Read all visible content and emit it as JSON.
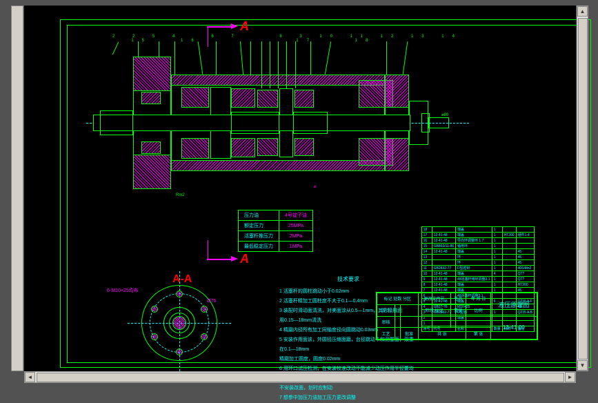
{
  "section_marker": "A",
  "section_label": "A-A",
  "balloons": [
    "2",
    "2",
    "5",
    "4",
    "6",
    "7",
    "8",
    "3",
    "10",
    "11",
    "12",
    "13",
    "14",
    "15",
    "16",
    "17",
    "18"
  ],
  "param_table": [
    {
      "label": "压力油",
      "value": "4号锭子油"
    },
    {
      "label": "额定压力",
      "value": "25MPa"
    },
    {
      "label": "活塞杆推压力",
      "value": "2MPa"
    },
    {
      "label": "最低稳定压力",
      "value": "1MPa"
    }
  ],
  "flange": {
    "bolt_spec": "6-M10×25均布",
    "diameter": "Ø76"
  },
  "notes_title": "技术要求",
  "notes": [
    "1 活塞杆的圆柱跳动小于0.02mm",
    "2 活塞杆精加工圆柱度不大于0.1—0.4mm",
    "3 装配时滑动面清洗，对美面涂从0.5—1mm，其它接触面",
    "  用0.15—18mm清洗",
    "4 精磨内径所有加工同轴度径向圆跳动0.03mm",
    "5 安装作用面该，外圆径压缩面磨，台径跳动卡和测量面，双重在0.1—18mm",
    "  精磨加工圆度，圆度0.02mm",
    "6 用环口试压检测，在安装校准改动不能减少动压作用半径要均匀",
    "  不安装改面，划时应制动",
    "7 想参中加压力油加工压力更改调整"
  ],
  "bom": [
    {
      "no": "18",
      "std": "",
      "name": "端盖",
      "qty": "1",
      "mat": "",
      "note": ""
    },
    {
      "no": "17",
      "std": "12-41-48",
      "name": "端盖",
      "qty": "1",
      "mat": "HT200",
      "note": "组件1-4"
    },
    {
      "no": "16",
      "std": "12-41-48",
      "name": "导向环调整环 1.7",
      "qty": "1",
      "mat": "",
      "note": ""
    },
    {
      "no": "15",
      "std": "GB893/11-86",
      "name": "轴用环",
      "qty": "1",
      "mat": "",
      "note": ""
    },
    {
      "no": "14",
      "std": "12-41-48",
      "name": "端盖",
      "qty": "1",
      "mat": "",
      "note": "45"
    },
    {
      "no": "13",
      "std": "",
      "name": "环",
      "qty": "1",
      "mat": "",
      "note": "45"
    },
    {
      "no": "12",
      "std": "",
      "name": "环",
      "qty": "1",
      "mat": "",
      "note": "45"
    },
    {
      "no": "11",
      "std": "GB2832-77",
      "name": "D型密封",
      "qty": "1",
      "mat": "",
      "note": "40SiMn2"
    },
    {
      "no": "10",
      "std": "12-41-48",
      "name": "端盖",
      "qty": "4",
      "mat": "",
      "note": "QT?"
    },
    {
      "no": "9",
      "std": "12-41-48",
      "name": "48活塞杆用环调整3.1",
      "qty": "1",
      "mat": "",
      "note": "QT?"
    },
    {
      "no": "8",
      "std": "12-41-48",
      "name": "端盖",
      "qty": "1",
      "mat": "",
      "note": "HT200"
    },
    {
      "no": "7",
      "std": "12-41-48",
      "name": "端盖",
      "qty": "1",
      "mat": "",
      "note": "45"
    },
    {
      "no": "6",
      "std": "",
      "name": "48活塞杆调整3.1",
      "qty": "",
      "mat": "",
      "note": ""
    },
    {
      "no": "5",
      "std": "12-41-48",
      "name": "端盖",
      "qty": "6",
      "mat": "",
      "note": "Q235 A.F"
    },
    {
      "no": "4",
      "std": "GB27-76",
      "name": "M10×25",
      "qty": "",
      "mat": "",
      "note": "45"
    },
    {
      "no": "3",
      "std": "GB2832-77",
      "name": "O型圈",
      "qty": "1",
      "mat": "",
      "note": "Q235 A.B"
    },
    {
      "no": "2",
      "std": "",
      "name": "端盖",
      "qty": "",
      "mat": "",
      "note": ""
    },
    {
      "no": "1",
      "std": "",
      "name": "",
      "qty": "",
      "mat": "",
      "note": ""
    }
  ],
  "bom_header": {
    "no": "序号",
    "std": "代号",
    "name": "名称",
    "qty": "数量",
    "mat": "材料",
    "note": "备注"
  },
  "title_block": {
    "drawing_name": "液压原理图",
    "designed": "标记 处数 分区",
    "date": "更改文件号",
    "sign": "签名",
    "year": "年 月 日",
    "drawn_label": "设计",
    "check_label": "审核",
    "process_label": "工艺",
    "approve_label": "批准",
    "stage": "阶段:标记",
    "weight": "重量",
    "scale": "比例",
    "sheet": "共 张",
    "page": "第 张",
    "drawing_no": "13-41-00"
  }
}
